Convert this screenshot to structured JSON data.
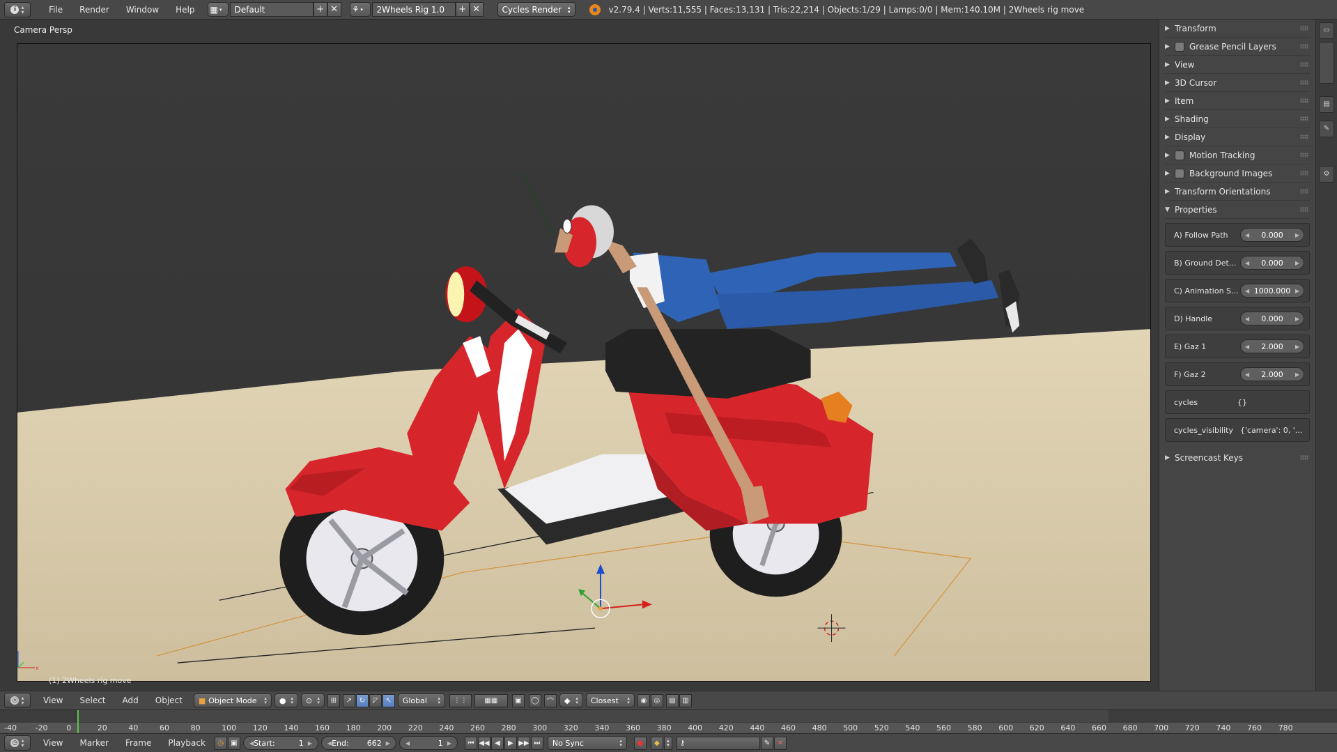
{
  "header": {
    "menus": [
      "File",
      "Render",
      "Window",
      "Help"
    ],
    "screen_layout": "Default",
    "scene_name": "2Wheels Rig 1.0",
    "render_engine": "Cycles Render",
    "stats": "v2.79.4 | Verts:11,555 | Faces:13,131 | Tris:22,214 | Objects:1/29 | Lamps:0/0 | Mem:140.10M | 2Wheels rig move"
  },
  "viewport": {
    "label": "Camera Persp",
    "object_label": "(1) 2Wheels rig move"
  },
  "npanel": {
    "sections_top": [
      {
        "label": "Transform",
        "checkbox": false
      },
      {
        "label": "Grease Pencil Layers",
        "checkbox": true
      },
      {
        "label": "View",
        "checkbox": false
      },
      {
        "label": "3D Cursor",
        "checkbox": false
      },
      {
        "label": "Item",
        "checkbox": false
      },
      {
        "label": "Shading",
        "checkbox": false
      },
      {
        "label": "Display",
        "checkbox": false
      },
      {
        "label": "Motion Tracking",
        "checkbox": true
      },
      {
        "label": "Background Images",
        "checkbox": true
      },
      {
        "label": "Transform Orientations",
        "checkbox": false
      }
    ],
    "properties_label": "Properties",
    "properties": [
      {
        "label": "A) Follow Path",
        "value": "0.000"
      },
      {
        "label": "B) Ground Det...",
        "value": "0.000"
      },
      {
        "label": "C) Animation S...",
        "value": "1000.000"
      },
      {
        "label": "D) Handle",
        "value": "0.000"
      },
      {
        "label": "E) Gaz 1",
        "value": "2.000"
      },
      {
        "label": "F) Gaz 2",
        "value": "2.000"
      }
    ],
    "text_props": [
      {
        "label": "cycles",
        "value": "{}"
      },
      {
        "label": "cycles_visibility",
        "value": "{'camera': 0, '..."
      }
    ],
    "screencast_label": "Screencast Keys"
  },
  "viewport_footer": {
    "menus": [
      "View",
      "Select",
      "Add",
      "Object"
    ],
    "mode": "Object Mode",
    "orientation": "Global",
    "snap_target": "Closest"
  },
  "timeline": {
    "ticks": [
      "-40",
      "-20",
      "0",
      "20",
      "40",
      "60",
      "80",
      "100",
      "120",
      "140",
      "160",
      "180",
      "200",
      "220",
      "240",
      "260",
      "280",
      "300",
      "320",
      "340",
      "360",
      "380",
      "400",
      "420",
      "440",
      "460",
      "480",
      "500",
      "520",
      "540",
      "560",
      "580",
      "600",
      "620",
      "640",
      "660",
      "680",
      "700",
      "720",
      "740",
      "760",
      "780"
    ]
  },
  "timeline_footer": {
    "menus": [
      "View",
      "Marker",
      "Frame",
      "Playback"
    ],
    "start_label": "Start:",
    "start_value": "1",
    "end_label": "End:",
    "end_value": "662",
    "current_frame": "1",
    "sync": "No Sync"
  }
}
